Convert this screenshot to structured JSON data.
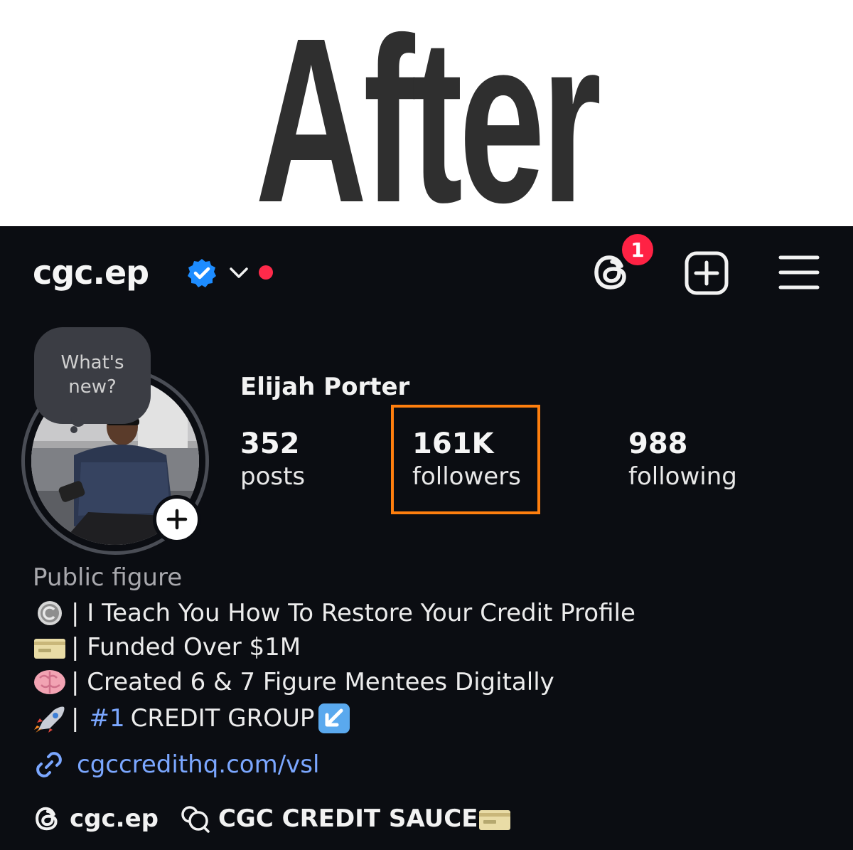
{
  "banner": {
    "title": "After"
  },
  "header": {
    "username": "cgc.ep",
    "notification_count": "1"
  },
  "avatar": {
    "note_line1": "What's",
    "note_line2": "new?"
  },
  "profile": {
    "full_name": "Elijah Porter",
    "stats": [
      {
        "value": "352",
        "label": "posts"
      },
      {
        "value": "161K",
        "label": "followers"
      },
      {
        "value": "988",
        "label": "following"
      }
    ]
  },
  "bio": {
    "category": "Public figure",
    "line1": "| I Teach You How To Restore Your Credit Profile",
    "line2": "| Funded Over $1M",
    "line3": "| Created 6 & 7 Figure Mentees Digitally",
    "line4_sep": "|",
    "line4_hashtag": "#1",
    "line4_text": "CREDIT GROUP",
    "link": "cgccredithq.com/vsl"
  },
  "footer": {
    "threads_handle": "cgc.ep",
    "channel_name": "CGC CREDIT SAUCE"
  },
  "colors": {
    "background": "#0b0d12",
    "accent_link": "#7ba7ff",
    "verified": "#1d8cff",
    "notification": "#ff2244",
    "highlight": "#ff7f0e"
  }
}
